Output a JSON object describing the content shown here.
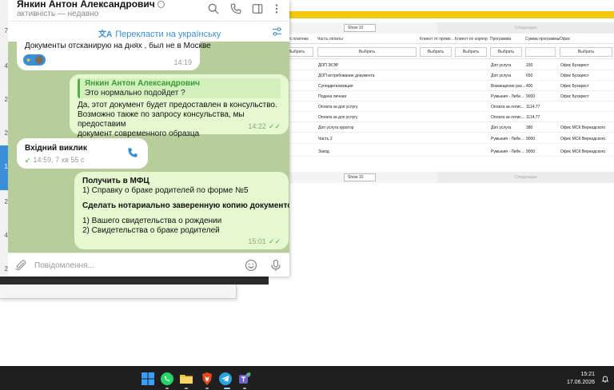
{
  "telegram": {
    "contact_name": "Янкин Антон Александрович",
    "status": "активність — недавно",
    "translate_label": "Перекласти на українську",
    "sidebar_numbers": [
      "7",
      "4",
      "2",
      "2",
      "1",
      "2",
      "4",
      "2"
    ],
    "messages": {
      "m1": {
        "text": "Документы отсканирую на днях , был не в Москве",
        "time": "14:19"
      },
      "m2": {
        "quote_name": "Янкин Антон Александрович",
        "quote_text": "Это нормально подойдет ?",
        "text": "Да, этот документ будет предоставлен в консульство.\nВозможно также по запросу консульства, мы предоставим\nдокумент современного образца",
        "time": "14:22"
      },
      "call": {
        "title": "Вхідний виклик",
        "subtitle": "14:59, 7 хв 55 с"
      },
      "m3": {
        "line1": "Получить в МФЦ",
        "line2": "1) Справку о браке родителей по форме №5",
        "line3": "Сделать нотариально заверенную копию документов",
        "line4": "1) Вашего свидетельства о рождении",
        "line5": "2) Свидетельства о браке родителей",
        "time": "15:01"
      }
    },
    "input_placeholder": "Повідомлення..."
  },
  "spreadsheet": {
    "pager": {
      "show": "Show 10",
      "next": "Следующая"
    },
    "headers": [
      "ус платежа",
      "Часть оплаты",
      "Клиент от проме...",
      "Клиент по корпор",
      "Программа",
      "Сумма программы",
      "Офис"
    ],
    "filter_placeholder": "Выбрать",
    "rows": [
      [
        "ДОП ЗКЭР",
        "Доп услуга",
        "150",
        "Офис Бухарест"
      ],
      [
        "ДОП истребование документа",
        "Доп услуга",
        "650",
        "Офис Бухарест"
      ],
      [
        "Супердегализация",
        "Возмещение рас...",
        "400",
        "Офис Бухарест"
      ],
      [
        "Подача личная",
        "Румыния - Либе...",
        "9000",
        "Офис Бухарест"
      ],
      [
        "Оплата за доп услугу",
        "Оплата за логис...",
        "1114.77",
        ""
      ],
      [
        "Оплата за доп услугу",
        "Оплата за логис...",
        "1114.77",
        ""
      ],
      [
        "Доп услуга куратор",
        "Доп услуга",
        "380",
        "Офис МСК Вернадского"
      ],
      [
        "Часть 2",
        "Румыния - Либе...",
        "9000",
        "Офис МСК Вернадского"
      ],
      [
        "Заход",
        "Румыния - Либе...",
        "9000",
        "Офис МСК Вернадского"
      ]
    ]
  },
  "taskbar": {
    "time": "15:21",
    "date": "17.06.2026",
    "apps": [
      "windows-start",
      "whatsapp",
      "file-explorer",
      "brave",
      "telegram",
      "teams"
    ],
    "colors": {
      "whatsapp": "#25d366",
      "explorer": "#f3c338",
      "brave": "#e24a1c",
      "telegram": "#2aa3e0",
      "teams": "#6b5fc9",
      "accent": "#3a8fd6",
      "yellow": "#f2c811"
    }
  }
}
